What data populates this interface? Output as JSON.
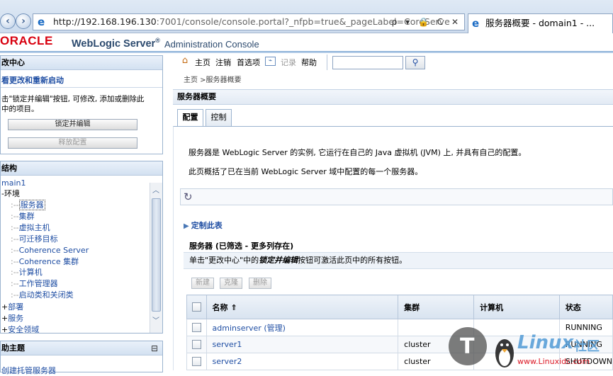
{
  "browser": {
    "url_main": "http://192.168.196.130",
    "url_rest": ":7001/console/console.portal?_nfpb=true&_pageLabel=CoreServe",
    "url_controls": "ρ ▾ 🔒 C ✕",
    "tab_title": "服务器概要 - domain1 - ..."
  },
  "header": {
    "oracle": "ORACLE",
    "product": "WebLogic Server",
    "registered": "®",
    "console": "Administration Console"
  },
  "change_center": {
    "title": "改中心",
    "subtitle": "看更改和重新启动",
    "desc_line1": "击\"锁定并编辑\"按钮, 可修改, 添加或删除此",
    "desc_line2": "中的项目。",
    "lock_button": "锁定并编辑",
    "release_button": "释放配置"
  },
  "domain_structure": {
    "title": "结构",
    "items": [
      {
        "prefix": "",
        "label": "main1"
      },
      {
        "prefix": "-",
        "label": "环境"
      },
      {
        "prefix": "",
        "label": "服务器"
      },
      {
        "prefix": "",
        "label": "集群"
      },
      {
        "prefix": "",
        "label": "虚拟主机"
      },
      {
        "prefix": "",
        "label": "可迁移目标"
      },
      {
        "prefix": "",
        "label": "Coherence Server"
      },
      {
        "prefix": "",
        "label": "Coherence 集群"
      },
      {
        "prefix": "",
        "label": "计算机"
      },
      {
        "prefix": "",
        "label": "工作管理器"
      },
      {
        "prefix": "",
        "label": "启动类和关闭类"
      },
      {
        "prefix": "+",
        "label": "部署"
      },
      {
        "prefix": "+",
        "label": "服务"
      },
      {
        "prefix": "+",
        "label": "安全领域"
      }
    ]
  },
  "help_panel": {
    "title": "助主题",
    "collapse": "⊟",
    "item": "创建托管服务器"
  },
  "toolbar": {
    "home": "主页",
    "logout": "注销",
    "preferences": "首选项",
    "record": "记录",
    "help": "帮助",
    "search_placeholder": "",
    "search_icon": "magnifier-icon"
  },
  "breadcrumb": "主页 >服务器概要",
  "section_title": "服务器概要",
  "tabs": [
    "配置",
    "控制"
  ],
  "description": {
    "line1": "服务器是 WebLogic Server 的实例, 它运行在自己的 Java 虚拟机 (JVM) 上, 并具有自己的配置。",
    "line2": "此页概括了已在当前 WebLogic Server 域中配置的每一个服务器。"
  },
  "customize": "定制此表",
  "table": {
    "title": "服务器 (已筛选 - 更多列存在)",
    "info_prefix": "单击\"更改中心\"中的",
    "info_em": "锁定并编辑",
    "info_suffix": "按钮可激活此页中的所有按钮。",
    "buttons": [
      "新建",
      "克隆",
      "删除"
    ],
    "columns": [
      "名称 ⇑",
      "集群",
      "计算机",
      "状态"
    ],
    "rows": [
      {
        "name": "adminserver (管理)",
        "cluster": "",
        "machine": "",
        "state": "RUNNING"
      },
      {
        "name": "server1",
        "cluster": "cluster",
        "machine": "",
        "state": "RUNNING"
      },
      {
        "name": "server2",
        "cluster": "cluster",
        "machine": "",
        "state": "SHUTDOWN"
      }
    ]
  },
  "watermark": {
    "text1": "Linux",
    "text2": "社区",
    "url": "www.Linuxidc.com"
  },
  "colors": {
    "oracle_red": "#d8000f",
    "link_blue": "#1f4ea3",
    "header_blue": "#2c4a6e"
  }
}
